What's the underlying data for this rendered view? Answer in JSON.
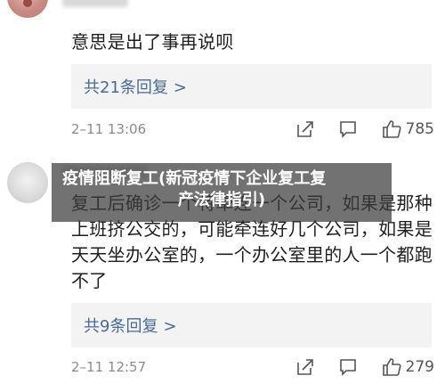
{
  "comments": [
    {
      "text": "意思是出了事再说呗",
      "replies": "共21条回复",
      "time": "2–11 13:06",
      "likes": "785"
    },
    {
      "text": "复工后确诊一个将牵连一个公司，如果是那种上班挤公交的，可能牵连好几个公司，如果是天天坐办公室的，一个办公室里的人一个都跑不了",
      "replies": "共9条回复",
      "time": "2–11 12:57",
      "likes": "279"
    }
  ],
  "banner": {
    "line1": "疫情阻断复工(新冠疫情下企业复工复",
    "line2": "产法律指引)"
  },
  "icons": {
    "reply_chevron": "chevron-right-icon",
    "share": "share-icon",
    "comment": "comment-icon",
    "like": "thumbs-up-icon"
  }
}
